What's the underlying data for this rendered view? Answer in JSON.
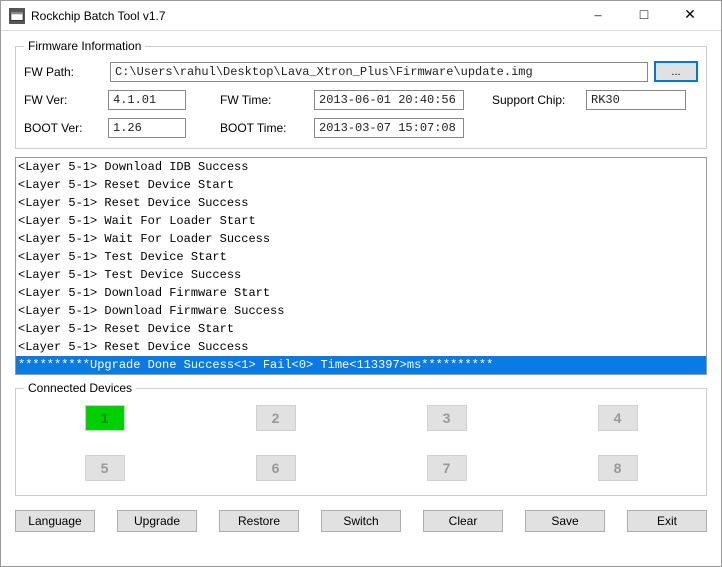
{
  "window": {
    "title": "Rockchip Batch Tool v1.7"
  },
  "firmware": {
    "legend": "Firmware Information",
    "fw_path_label": "FW Path:",
    "fw_path": "C:\\Users\\rahul\\Desktop\\Lava_Xtron_Plus\\Firmware\\update.img",
    "browse": "...",
    "fw_ver_label": "FW Ver:",
    "fw_ver": "4.1.01",
    "fw_time_label": "FW Time:",
    "fw_time": "2013-06-01 20:40:56",
    "support_chip_label": "Support Chip:",
    "support_chip": "RK30",
    "boot_ver_label": "BOOT Ver:",
    "boot_ver": "1.26",
    "boot_time_label": "BOOT Time:",
    "boot_time": "2013-03-07 15:07:08"
  },
  "log": {
    "lines": [
      "<Layer 5-1> Download IDB Success",
      "<Layer 5-1> Reset Device Start",
      "<Layer 5-1> Reset Device Success",
      "<Layer 5-1> Wait For Loader Start",
      "<Layer 5-1> Wait For Loader Success",
      "<Layer 5-1> Test Device Start",
      "<Layer 5-1> Test Device Success",
      "<Layer 5-1> Download Firmware Start",
      "<Layer 5-1> Download Firmware Success",
      "<Layer 5-1> Reset Device Start",
      "<Layer 5-1> Reset Device Success"
    ],
    "highlight": "**********Upgrade Done Success<1> Fail<0> Time<113397>ms**********"
  },
  "devices": {
    "legend": "Connected Devices",
    "slots": [
      {
        "n": "1",
        "active": true
      },
      {
        "n": "2",
        "active": false
      },
      {
        "n": "3",
        "active": false
      },
      {
        "n": "4",
        "active": false
      },
      {
        "n": "5",
        "active": false
      },
      {
        "n": "6",
        "active": false
      },
      {
        "n": "7",
        "active": false
      },
      {
        "n": "8",
        "active": false
      }
    ]
  },
  "actions": {
    "language": "Language",
    "upgrade": "Upgrade",
    "restore": "Restore",
    "switch": "Switch",
    "clear": "Clear",
    "save": "Save",
    "exit": "Exit"
  }
}
